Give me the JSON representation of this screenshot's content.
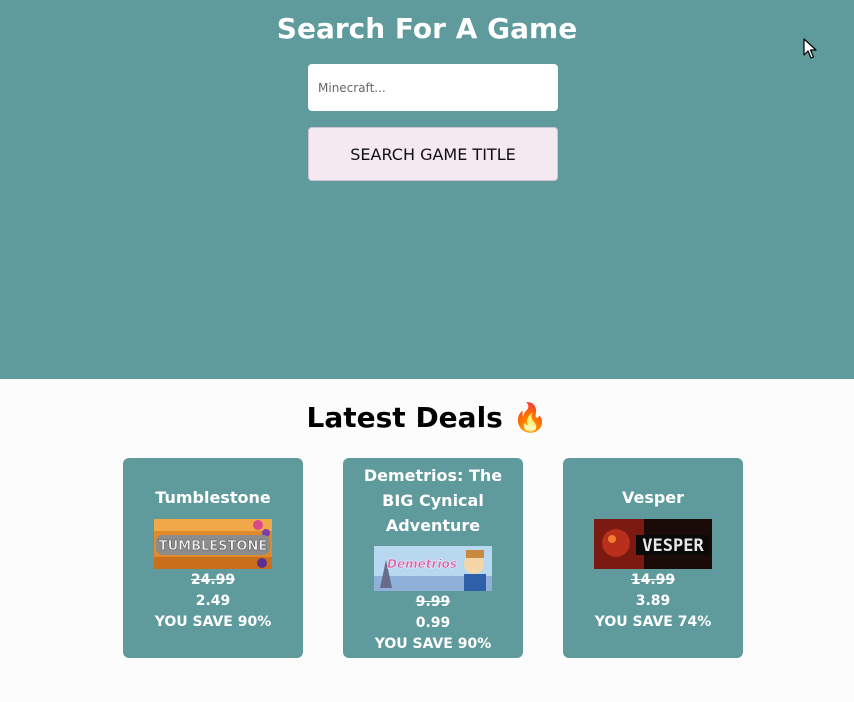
{
  "header": {
    "title": "Search For A Game",
    "search_placeholder": "Minecraft...",
    "search_button_label": "SEARCH GAME TITLE"
  },
  "deals": {
    "title": "Latest Deals",
    "emoji": "🔥",
    "items": [
      {
        "title": "Tumblestone",
        "image_text": "TUMBLESTONE",
        "normal_price": "24.99",
        "sale_price": "2.49",
        "savings": "YOU SAVE 90%"
      },
      {
        "title": "Demetrios: The BIG Cynical Adventure",
        "image_text": "Demetrios",
        "normal_price": "9.99",
        "sale_price": "0.99",
        "savings": "YOU SAVE 90%"
      },
      {
        "title": "Vesper",
        "image_text": "VESPER",
        "normal_price": "14.99",
        "sale_price": "3.89",
        "savings": "YOU SAVE 74%"
      }
    ]
  },
  "colors": {
    "hero_bg": "#5f9b9d",
    "card_bg": "#5f9b9d",
    "button_bg": "#f4e8f1",
    "page_bg": "#fcfcfc"
  }
}
